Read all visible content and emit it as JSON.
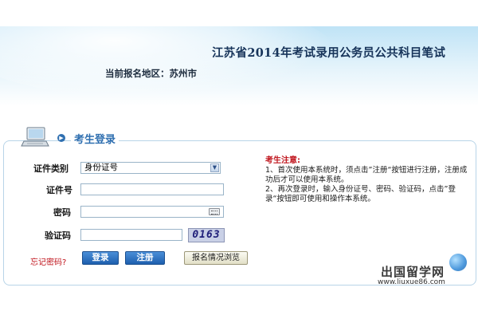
{
  "header": {
    "title": "江苏省2014年考试录用公务员公共科目笔试",
    "region_label": "当前报名地区：",
    "region_value": "苏州市"
  },
  "login": {
    "panel_title": "考生登录",
    "id_type_label": "证件类别",
    "id_type_selected": "身份证号",
    "id_number_label": "证件号",
    "id_number_value": "",
    "password_label": "密码",
    "password_value": "",
    "captcha_label": "验证码",
    "captcha_value": "",
    "captcha_code": "0163",
    "forgot_password": "忘记密码?",
    "login_button": "登录",
    "register_button": "注册",
    "status_button": "报名情况浏览"
  },
  "notice": {
    "title": "考生注意:",
    "lines": [
      "1、首次使用本系统时，须点击”注册“按钮进行注册，注册成功后才可以使用本系统。",
      "2、再次登录时，输入身份证号、密码、验证码，点击”登录“按钮即可使用和操作本系统。"
    ]
  },
  "watermark": {
    "brand": "出国留学网",
    "url": "www.liuxue86.com"
  },
  "icons": {
    "computer": "computer-icon",
    "bullet": "bullet-arrow-icon",
    "dropdown": "chevron-down-icon",
    "keyboard": "keyboard-icon",
    "globe": "globe-icon"
  },
  "colors": {
    "accent": "#2f6fb0",
    "warning": "#c0141c",
    "header_bg": "#bfe3f6"
  }
}
